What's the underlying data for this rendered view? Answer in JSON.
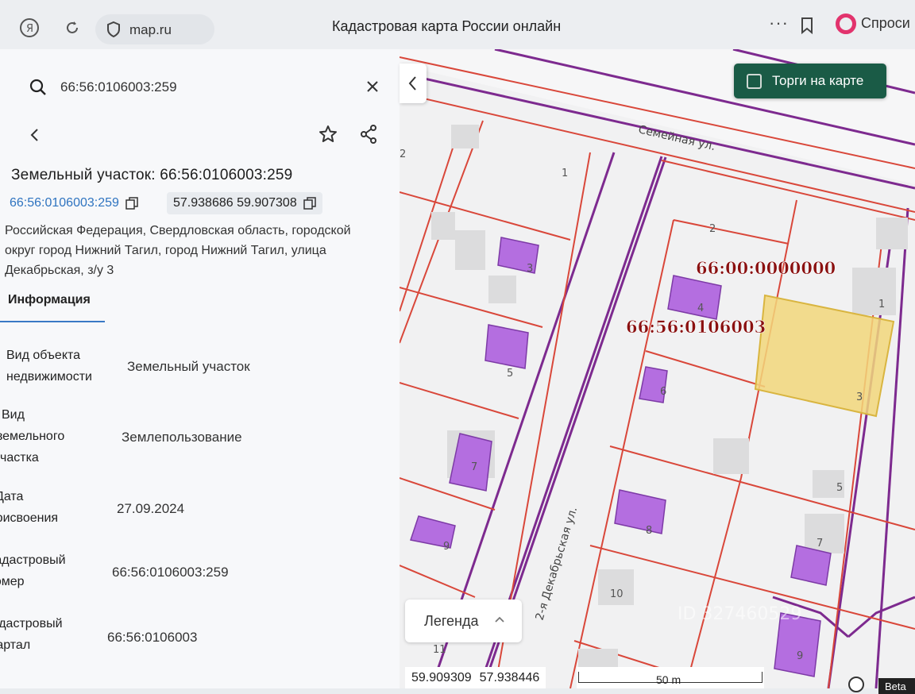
{
  "browser": {
    "url": "map.ru",
    "title": "Кадастровая карта России онлайн",
    "more_icon": "ellipsis-icon",
    "ask_label": "Спроси"
  },
  "panel": {
    "search_value": "66:56:0106003:259",
    "object_title": "Земельный участок: 66:56:0106003:259",
    "cadastral_link": "66:56:0106003:259",
    "coordinates": "57.938686 59.907308",
    "address": "Российская Федерация, Свердловская область, городской округ город Нижний Тагил, город Нижний Тагил, улица Декабрьская, з/у 3",
    "tab_info": "Информация",
    "rows": [
      {
        "label": [
          "Вид объекта",
          "недвижимости"
        ],
        "value": "Земельный участок"
      },
      {
        "label": [
          "Вид",
          "земельного",
          "участка"
        ],
        "value": "Землепользование"
      },
      {
        "label": [
          "Дата",
          "присвоения"
        ],
        "value": "27.09.2024"
      },
      {
        "label": [
          "Кадастровый",
          "номер"
        ],
        "value": "66:56:0106003:259"
      },
      {
        "label": [
          "Кадастровый",
          "квартал"
        ],
        "value": "66:56:0106003"
      }
    ]
  },
  "map": {
    "torgi_label": "Торги на карте",
    "street_top": "Семейная ул.",
    "street_vertical": "2-я Декабрьская ул.",
    "region_label": "66:00:0000000",
    "quarter_label": "66:56:0106003",
    "parcel_numbers": [
      "2",
      "1",
      "3",
      "5",
      "7",
      "9",
      "11",
      "2",
      "4",
      "6",
      "8",
      "10",
      "1",
      "3",
      "5",
      "7",
      "9"
    ],
    "legend_label": "Легенда",
    "coord_lon": "59.909309",
    "coord_lat": "57.938446",
    "scale_label": "50 m",
    "beta_label": "Beta",
    "watermark": "ID 327460529",
    "colors": {
      "boundary": "#d9473a",
      "street": "#7d2a8f",
      "building": "#b46ee0",
      "selected": "#f2d77b",
      "label": "#8a1010"
    }
  }
}
